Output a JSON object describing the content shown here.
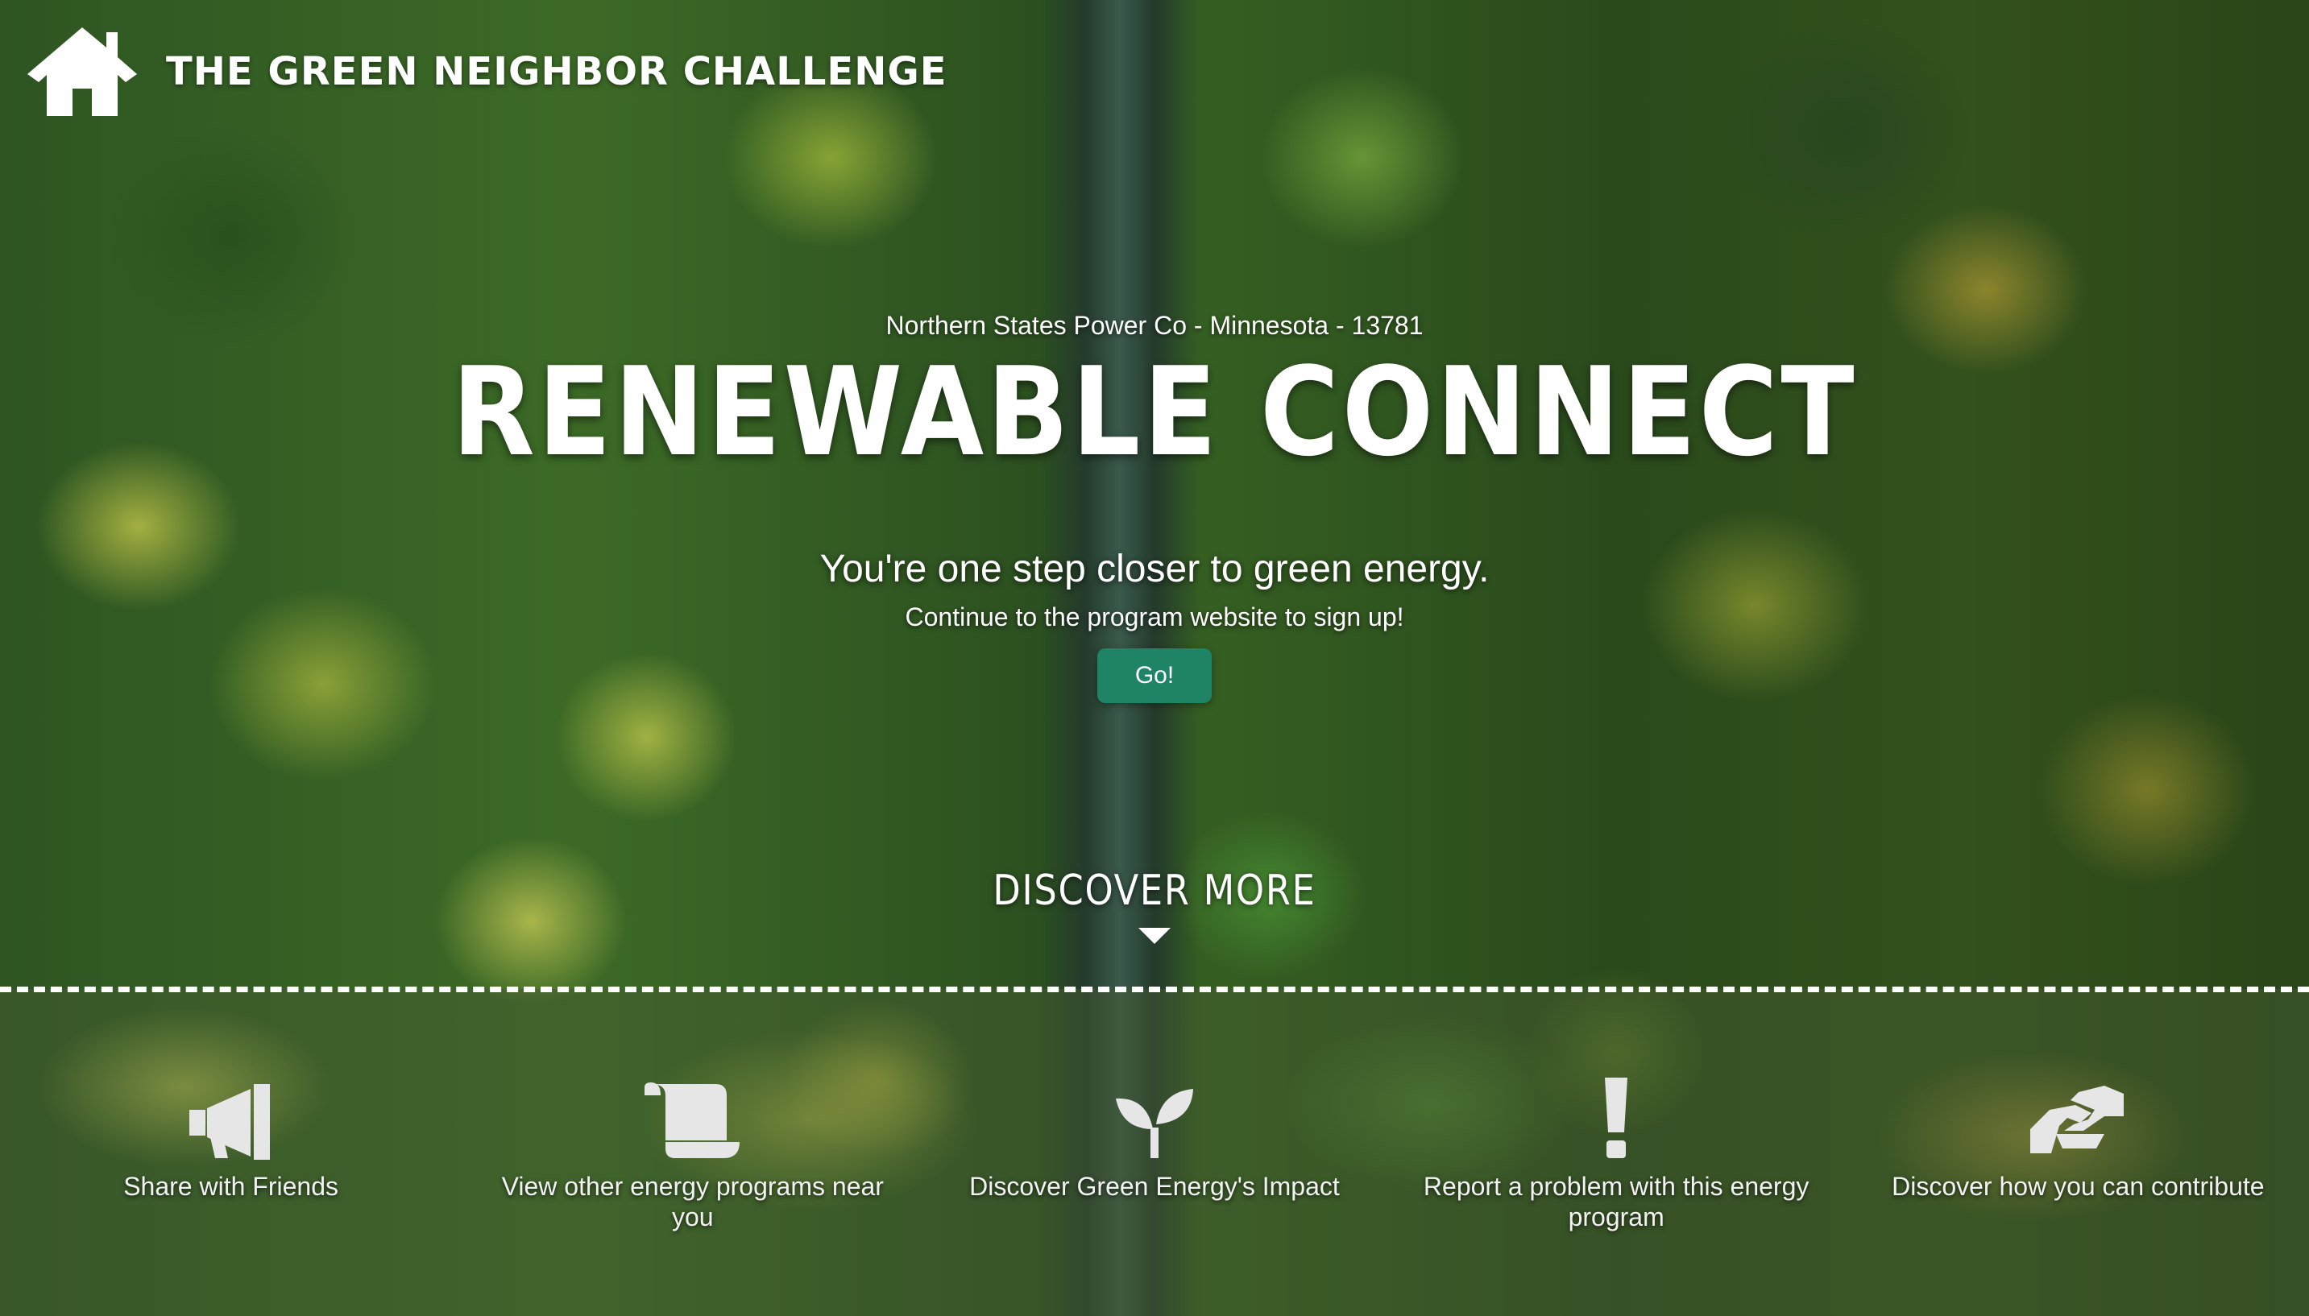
{
  "header": {
    "brand": "The Green Neighbor Challenge",
    "home_icon": "home-icon"
  },
  "hero": {
    "utility": "Northern States Power Co - Minnesota - 13781",
    "program_title": "Renewable Connect",
    "tagline": "You're one step closer to green energy.",
    "subtext": "Continue to the program website to sign up!",
    "go_label": "Go!"
  },
  "discover": {
    "label": "Discover More",
    "arrow_icon": "caret-down-icon"
  },
  "actions": [
    {
      "label": "Share with Friends",
      "icon": "megaphone-icon"
    },
    {
      "label": "View other energy programs near you",
      "icon": "scroll-icon"
    },
    {
      "label": "Discover Green Energy's Impact",
      "icon": "sprout-icon"
    },
    {
      "label": "Report a problem with this energy program",
      "icon": "exclamation-icon"
    },
    {
      "label": "Discover how you can contribute",
      "icon": "handshake-icon"
    }
  ],
  "colors": {
    "go_button": "#1f8466",
    "text": "#ffffff",
    "icon": "#e6e6e6"
  }
}
